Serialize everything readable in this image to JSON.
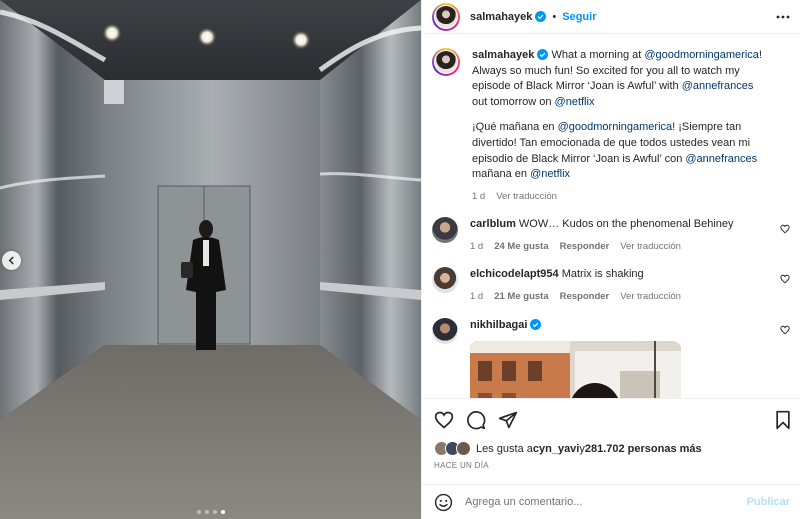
{
  "header": {
    "username": "salmahayek",
    "follow_label": "Seguir",
    "separator": "•"
  },
  "caption": {
    "username": "salmahayek",
    "text_en_1": "What a morning at ",
    "mention_gma": "@goodmorningamerica",
    "text_en_2": "! Always so much fun! So excited for you all to watch my episode of Black Mirror ‘Joan is Awful’ with ",
    "mention_anne": "@annefrances",
    "text_en_3": " out tomorrow on ",
    "mention_netflix": "@netflix",
    "text_es_1": "¡Qué mañana en ",
    "text_es_2": "! ¡Siempre tan divertido! Tan emocionada de que todos ustedes vean mi episodio de Black Mirror ‘Joan is Awful’ con ",
    "text_es_3": " mañana en ",
    "time": "1 d",
    "translate": "Ver traducción"
  },
  "comments": [
    {
      "username": "carlblum",
      "text": "WOW… Kudos on the phenomenal Behiney",
      "time": "1 d",
      "likes": "24 Me gusta",
      "reply": "Responder",
      "translate": "Ver traducción"
    },
    {
      "username": "elchicodelapt954",
      "text": "Matrix is shaking",
      "time": "1 d",
      "likes": "21 Me gusta",
      "reply": "Responder",
      "translate": "Ver traducción"
    },
    {
      "username": "nikhilbagai",
      "text": ""
    }
  ],
  "likes": {
    "prefix": "Les gusta a ",
    "first": "cyn_yavi",
    "middle": " y ",
    "count": "281.702 personas más"
  },
  "time_ago": "HACE UN DÍA",
  "add_comment": {
    "placeholder": "Agrega un comentario...",
    "publish_label": "Publicar"
  },
  "carousel": {
    "slides": 4,
    "active_index": 3
  },
  "colors": {
    "link_blue": "#0095f6",
    "mention_blue": "#00376b",
    "muted": "#737373",
    "publish_disabled": "#b2dffc"
  },
  "icons": {
    "verified": "verified-badge-icon",
    "more": "more-options-icon",
    "like": "heart-icon",
    "comment": "comment-icon",
    "share": "send-icon",
    "save": "bookmark-icon",
    "emoji": "emoji-icon",
    "prev": "chevron-left-icon"
  }
}
